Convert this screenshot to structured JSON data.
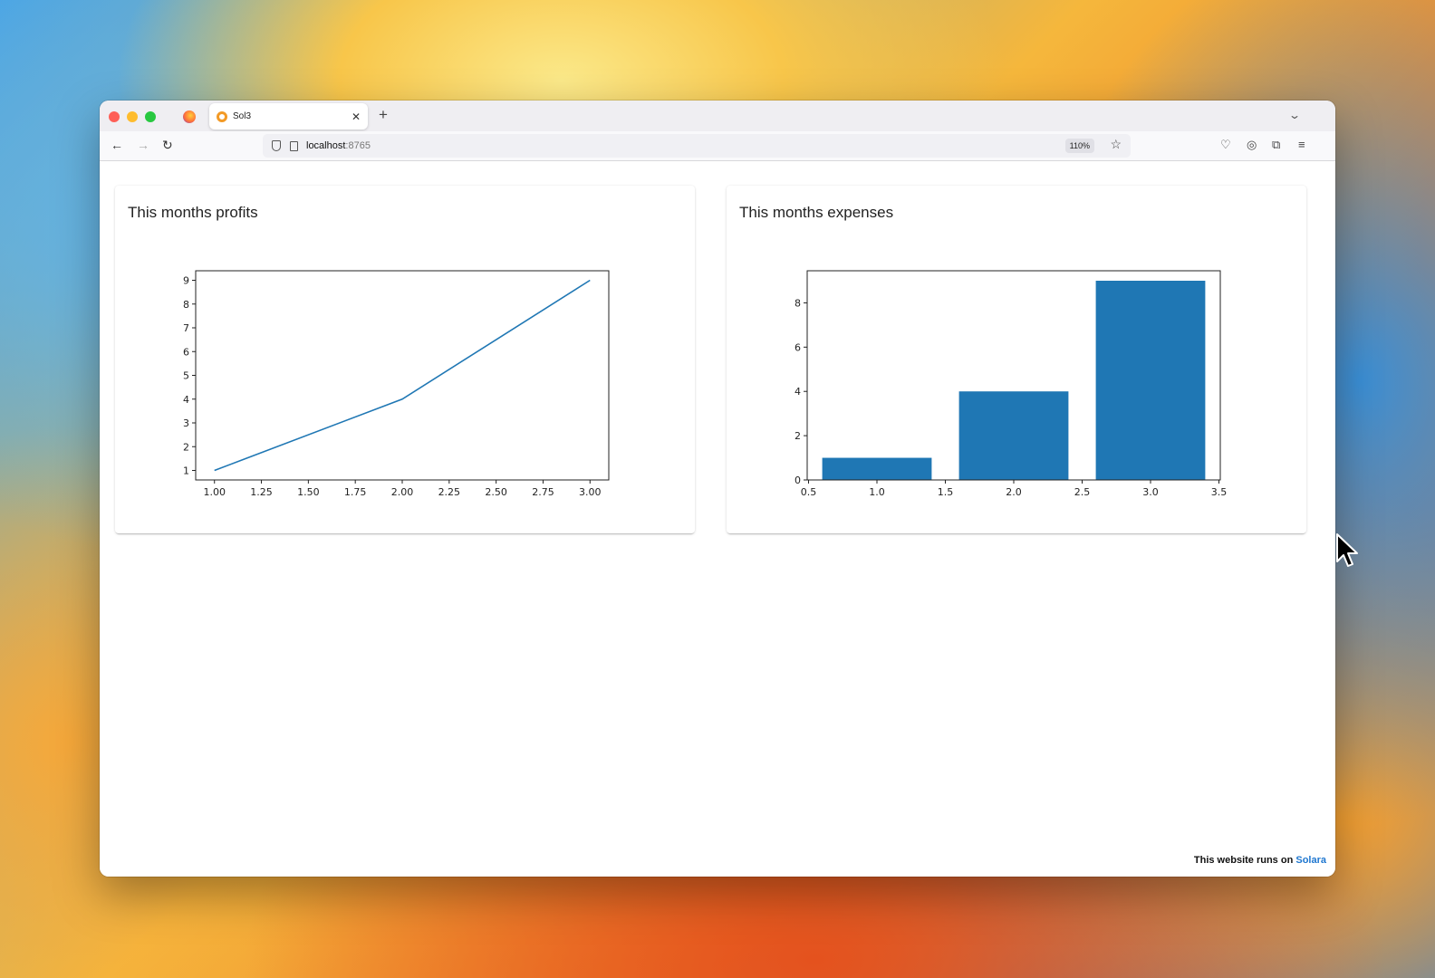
{
  "browser": {
    "tab_title": "Sol3",
    "tab_close": "✕",
    "new_tab": "+",
    "url_host": "localhost",
    "url_port": ":8765",
    "zoom": "110%"
  },
  "cards": [
    {
      "title": "This months profits"
    },
    {
      "title": "This months expenses"
    }
  ],
  "footer": {
    "text": "This website runs on ",
    "link": "Solara"
  },
  "chart_data": [
    {
      "type": "line",
      "x": [
        1,
        2,
        3
      ],
      "y": [
        1,
        4,
        9
      ],
      "xlim": [
        0.9,
        3.1
      ],
      "ylim": [
        0.6,
        9.4
      ],
      "xticks": [
        1.0,
        1.25,
        1.5,
        1.75,
        2.0,
        2.25,
        2.5,
        2.75,
        3.0
      ],
      "xtick_labels": [
        "1.00",
        "1.25",
        "1.50",
        "1.75",
        "2.00",
        "2.25",
        "2.50",
        "2.75",
        "3.00"
      ],
      "yticks": [
        1,
        2,
        3,
        4,
        5,
        6,
        7,
        8,
        9
      ],
      "ytick_labels": [
        "1",
        "2",
        "3",
        "4",
        "5",
        "6",
        "7",
        "8",
        "9"
      ],
      "color": "#1f77b4",
      "grid": false
    },
    {
      "type": "bar",
      "x": [
        1,
        2,
        3
      ],
      "values": [
        1,
        4,
        9
      ],
      "bar_width": 0.8,
      "xlim": [
        0.49,
        3.51
      ],
      "ylim": [
        0,
        9.45
      ],
      "xticks": [
        0.5,
        1.0,
        1.5,
        2.0,
        2.5,
        3.0,
        3.5
      ],
      "xtick_labels": [
        "0.5",
        "1.0",
        "1.5",
        "2.0",
        "2.5",
        "3.0",
        "3.5"
      ],
      "yticks": [
        0,
        2,
        4,
        6,
        8
      ],
      "ytick_labels": [
        "0",
        "2",
        "4",
        "6",
        "8"
      ],
      "color": "#1f77b4",
      "grid": false
    }
  ]
}
